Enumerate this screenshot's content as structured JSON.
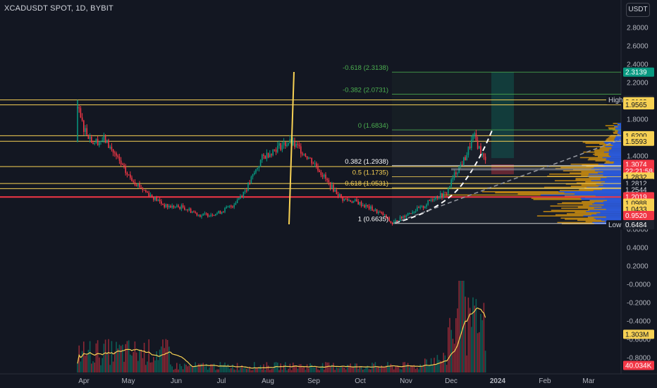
{
  "chart": {
    "title": "XCADUSDT SPOT, 1D, BYBIT",
    "currency_button": "USDT"
  },
  "fib_levels": [
    {
      "label": "-0.618 (2.3138)",
      "price": 2.3138,
      "color": "#4caf50"
    },
    {
      "label": "-0.382 (2.0731)",
      "price": 2.0731,
      "color": "#4caf50"
    },
    {
      "label": "0 (1.6834)",
      "price": 1.6834,
      "color": "#4caf50"
    },
    {
      "label": "0.382 (1.2938)",
      "price": 1.2938,
      "color": "#ffffff"
    },
    {
      "label": "0.5 (1.1735)",
      "price": 1.1735,
      "color": "#f7d154"
    },
    {
      "label": "0.618 (1.0531)",
      "price": 1.0531,
      "color": "#f7d154"
    },
    {
      "label": "1 (0.6635)",
      "price": 0.6635,
      "color": "#ffffff"
    }
  ],
  "price_axis": {
    "ticks": [
      "2.8000",
      "2.6000",
      "2.4000",
      "2.2000",
      "1.8000",
      "1.4000",
      "0.8000",
      "0.6000",
      "0.4000",
      "0.2000",
      "-0.0000",
      "-0.2000",
      "-0.4000",
      "-0.6000",
      "-0.8000"
    ],
    "tick_values": [
      2.8,
      2.6,
      2.4,
      2.2,
      1.8,
      1.4,
      0.8,
      0.6,
      0.4,
      0.2,
      0,
      -0.2,
      -0.4,
      -0.6,
      -0.8
    ]
  },
  "price_tags": [
    {
      "text": "2.3139",
      "value": 2.3139,
      "bg": "#089981",
      "fg": "#ffffff"
    },
    {
      "text": "High",
      "value": 2.0102,
      "bg": "#131722",
      "fg": "#d1d4dc",
      "side": "left"
    },
    {
      "text": "2.0102",
      "value": 2.0102,
      "bg": "#1e222d",
      "fg": "#ffffff"
    },
    {
      "text": "2.0102",
      "value": 1.99,
      "bg": "#f7d154",
      "fg": "#131722"
    },
    {
      "text": "1.9565",
      "value": 1.9565,
      "bg": "#f7d154",
      "fg": "#131722"
    },
    {
      "text": "1.6200",
      "value": 1.62,
      "bg": "#f7d154",
      "fg": "#131722"
    },
    {
      "text": "1.5593",
      "value": 1.5593,
      "bg": "#f7d154",
      "fg": "#131722"
    },
    {
      "text": "1.3074",
      "value": 1.3074,
      "bg": "#f23645",
      "fg": "#ffffff"
    },
    {
      "text": "22:21:58",
      "value": 1.235,
      "bg": "#f23645",
      "fg": "#ffffff"
    },
    {
      "text": "1.2832",
      "value": 1.17,
      "bg": "#f7d154",
      "fg": "#131722"
    },
    {
      "text": "1.2812",
      "value": 1.1,
      "bg": "#131722",
      "fg": "#d1d4dc"
    },
    {
      "text": "1.2544",
      "value": 1.03,
      "bg": "#131722",
      "fg": "#d1d4dc"
    },
    {
      "text": "1.2019",
      "value": 0.955,
      "bg": "#f23645",
      "fg": "#ffffff"
    },
    {
      "text": "1.0988",
      "value": 0.885,
      "bg": "#f7d154",
      "fg": "#131722"
    },
    {
      "text": "1.0433",
      "value": 0.82,
      "bg": "#f7d154",
      "fg": "#131722"
    },
    {
      "text": "0.9520",
      "value": 0.75,
      "bg": "#f23645",
      "fg": "#ffffff"
    },
    {
      "text": "Low",
      "value": 0.6484,
      "bg": "#131722",
      "fg": "#d1d4dc",
      "side": "left"
    },
    {
      "text": "0.6484",
      "value": 0.6484,
      "bg": "#1e222d",
      "fg": "#ffffff"
    },
    {
      "text": "1.303M",
      "value": -0.545,
      "bg": "#f7d154",
      "fg": "#131722"
    },
    {
      "text": "40.034K",
      "value": -0.885,
      "bg": "#f23645",
      "fg": "#ffffff"
    }
  ],
  "time_axis": [
    "Apr",
    "May",
    "Jun",
    "Jul",
    "Aug",
    "Sep",
    "Oct",
    "Nov",
    "Dec",
    "2024",
    "Feb",
    "Mar"
  ],
  "horizontal_levels": [
    {
      "price": 2.0102,
      "color": "#f7d154"
    },
    {
      "price": 1.9565,
      "color": "#f7d154"
    },
    {
      "price": 1.62,
      "color": "#f7d154"
    },
    {
      "price": 1.5593,
      "color": "#f7d154"
    },
    {
      "price": 1.2832,
      "color": "#f7d154"
    },
    {
      "price": 1.0988,
      "color": "#f7d154"
    },
    {
      "price": 1.0433,
      "color": "#f7d154"
    }
  ],
  "red_level": {
    "price": 0.952,
    "color": "#f23645"
  },
  "colors": {
    "up": "#089981",
    "down": "#f23645",
    "volume_ma": "#f7d154",
    "accent": "#2962ff"
  }
}
